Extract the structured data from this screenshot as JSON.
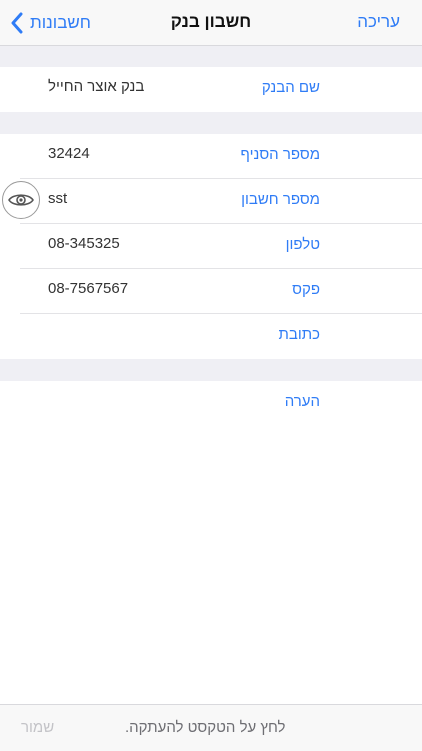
{
  "navbar": {
    "title": "חשבון בנק",
    "edit_label": "עריכה",
    "back_label": "חשבונות"
  },
  "bank_section": {
    "bank_name_label": "שם הבנק",
    "bank_name_value": "בנק אוצר החייל"
  },
  "details_section": {
    "rows": [
      {
        "label": "מספר הסניף",
        "value": "32424"
      },
      {
        "label": "מספר חשבון",
        "value": "sst"
      },
      {
        "label": "טלפון",
        "value": "08-345325"
      },
      {
        "label": "פקס",
        "value": "08-7567567"
      },
      {
        "label": "כתובת",
        "value": ""
      }
    ]
  },
  "notes_section": {
    "label": "הערה"
  },
  "toolbar": {
    "save_label": "שמור",
    "hint": "לחץ על הטקסט להעתקה."
  },
  "icons": {
    "back": "chevron-left-icon",
    "reveal": "eye-icon"
  },
  "colors": {
    "accent": "#2f7cf6",
    "background": "#efeff4"
  }
}
